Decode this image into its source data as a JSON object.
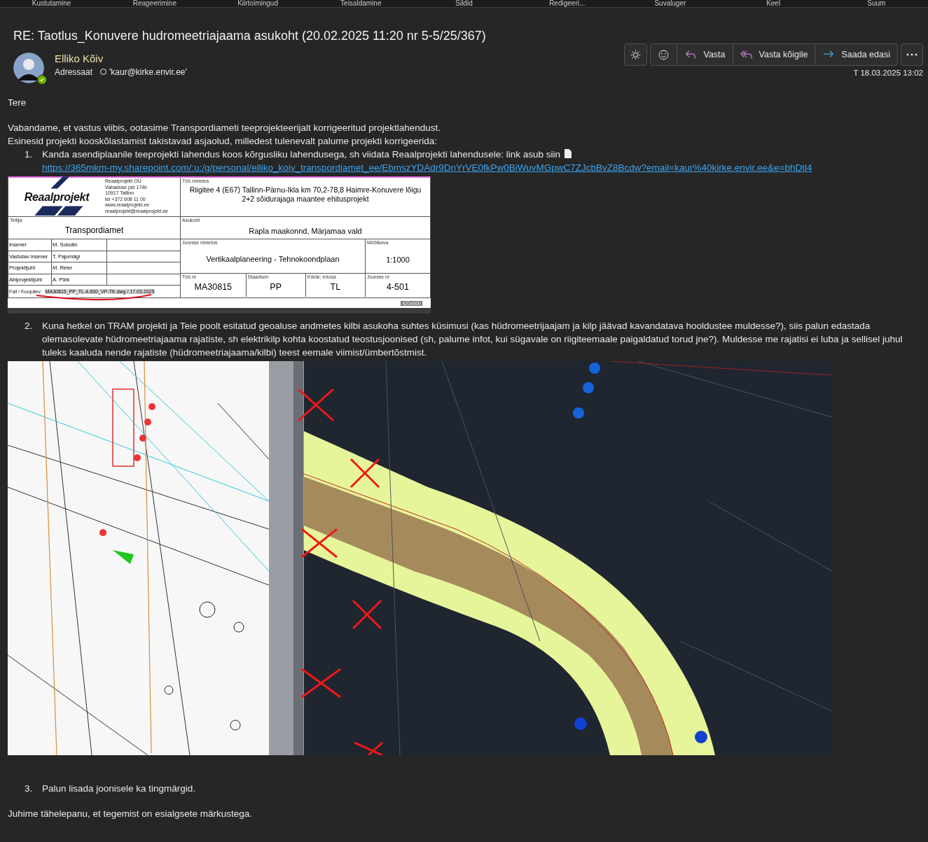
{
  "ribbon_groups": [
    "Kustutamine",
    "Reageerimine",
    "Kiirtoimingud",
    "Teisaldamine",
    "Sildid",
    "Redigeeri...",
    "Suvaluger",
    "Keel",
    "Suum"
  ],
  "message": {
    "subject": "RE: Taotlus_Konuvere hudromeetriajaama asukoht (20.02.2025 11:20 nr 5-5/25/367)",
    "sender": {
      "name": "Elliko Kõiv",
      "online": true
    },
    "recipient_label": "Adressaat",
    "recipient": "'kaur@kirke.envir.ee'",
    "date": "T 18.03.2025 13:02",
    "actions": [
      {
        "kind": "theme"
      },
      {
        "kind": "emoji"
      },
      {
        "kind": "reply",
        "label": "Vasta"
      },
      {
        "kind": "reply_all",
        "label": "Vasta kõigile"
      },
      {
        "kind": "forward",
        "label": "Saada edasi"
      },
      {
        "kind": "more"
      }
    ]
  },
  "body": {
    "greeting": "Tere",
    "paragraphs": [
      "Vabandame, et vastus viibis, ootasime Transpordiameti teeprojekteerijalt korrigeeritud projektlahendust.",
      "Esinesid projekti kooskõlastamist takistavad asjaolud, milledest tulenevalt palume projekti korrigeerida:"
    ],
    "items": [
      {
        "number": "1.",
        "text": "Kanda asendiplaanile teeprojekti lahendus koos kõrgusliku lahendusega, sh viidata Reaalprojekti lahendusele: link asub siin",
        "link": "https://365mkm-my.sharepoint.com/:u:/g/personal/elliko_koiv_transpordiamet_ee/EbmszYDAdr9DnYrVE0fkPw0BiWuvMGpwC7ZJcbBvZ8Bcdw?email=kaur%40kirke.envir.ee&e=bhDtl4",
        "kind": "title_block"
      },
      {
        "number": "2.",
        "text": "Kuna hetkel on TRAM projekti ja Teie poolt esitatud geoaluse andmetes kilbi asukoha suhtes küsimusi (kas hüdromeetrijaajam ja kilp jäävad kavandatava hooldustee muldesse?), siis palun edastada olemasolevate hüdromeetriajaama rajatiste, sh elektrikilp kohta koostatud teostusjoonised (sh, palume infot, kui sügavale on riigiteemaale paigaldatud torud jne?). Muldesse me rajatisi ei luba ja sellisel juhul tuleks kaaluda nende rajatiste (hüdromeetriajaama/kilbi) teest eemale viimist/ümbertõstmist.",
        "kind": "plan"
      },
      {
        "number": "3.",
        "text": "Palun lisada joonisele ka tingmärgid.",
        "kind": "text"
      }
    ],
    "closing": "Juhime tähelepanu, et tegemist on esialgsete märkustega."
  },
  "title_block": {
    "logo": "Reaalprojekt",
    "company_lines": [
      "Reaalprojekt OÜ",
      "Vabaduse pst 174b",
      "10917 Tallinn",
      "tel +372 608 11 00",
      "www.reaalprojekt.ee",
      "reaalprojekt@reaalprojekt.ee"
    ],
    "client": {
      "label": "Tellija",
      "value": "Transpordiamet"
    },
    "people": [
      {
        "role": "Insener",
        "name": "M. Solodin"
      },
      {
        "role": "Vastutav insener",
        "name": "T. Pajumägi"
      },
      {
        "role": "Projektijuht",
        "name": "M. Reier"
      },
      {
        "role": "Abiprojektijuht",
        "name": "A. Põrk"
      }
    ],
    "file": {
      "label": "Fail / Kuupäev:",
      "value": "MA30815_PP_TL-4-500_VP-TK.dwg / 17.03.2025"
    },
    "work_name": {
      "label": "Töö nimetus",
      "lines": [
        "Riigitee 4 (E67) Tallinn-Pärnu-Ikla km 70,2-78,8 Haimre-Konuvere lõigu",
        "2+2 sõidurajaga maantee ehitusprojekt"
      ]
    },
    "location": {
      "label": "Asukoht",
      "value": "Rapla maakonnd, Märjamaa vald"
    },
    "drawing_name": {
      "label": "Joonise nimetus",
      "value": "Vertikaalplaneering - Tehnokoondplaan"
    },
    "scale": {
      "label": "Mõõtkava",
      "value": "1:1000"
    },
    "codes": [
      {
        "label": "Töö nr",
        "value": "MA30815"
      },
      {
        "label": "Staadium",
        "value": "PP"
      },
      {
        "label": "Köide; eriosa",
        "value": "TL"
      },
      {
        "label": "Joonise nr",
        "value": "4-501"
      }
    ],
    "size_label": "420x600"
  }
}
